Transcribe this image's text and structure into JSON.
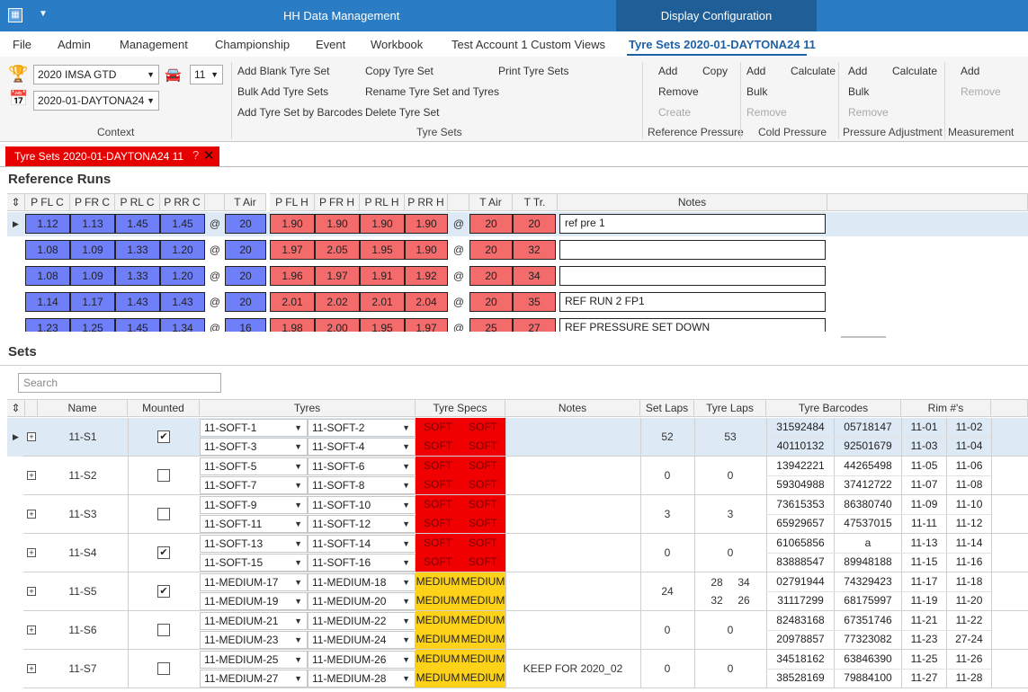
{
  "titlebar": {
    "title": "HH Data Management",
    "context_tab": "Display Configuration",
    "app_icon": "app-logo-icon",
    "menu_icon": "chevron-down-icon"
  },
  "menu": {
    "items": [
      "File",
      "Admin",
      "Management",
      "Championship",
      "Event",
      "Workbook",
      "Test Account 1 Custom Views"
    ],
    "active": "Tyre Sets 2020-01-DAYTONA24 11"
  },
  "ribbon": {
    "context": {
      "championship": "2020 IMSA GTD",
      "car": "11",
      "event": "2020-01-DAYTONA24",
      "label": "Context"
    },
    "tyresets": {
      "add_blank": "Add Blank Tyre Set",
      "bulk_add": "Bulk Add Tyre Sets",
      "add_barcodes": "Add Tyre Set by Barcodes",
      "copy": "Copy Tyre Set",
      "rename": "Rename Tyre Set and Tyres",
      "delete": "Delete Tyre Set",
      "print": "Print Tyre Sets",
      "label": "Tyre Sets"
    },
    "refpressure": {
      "add": "Add",
      "copy": "Copy",
      "remove": "Remove",
      "create": "Create",
      "label": "Reference Pressure"
    },
    "coldpressure": {
      "add": "Add",
      "calculate": "Calculate",
      "bulk": "Bulk",
      "remove": "Remove",
      "label": "Cold Pressure"
    },
    "pressureadj": {
      "add": "Add",
      "calculate": "Calculate",
      "bulk": "Bulk",
      "remove": "Remove",
      "label": "Pressure Adjustment"
    },
    "measurement": {
      "add": "Add",
      "remove": "Remove",
      "label": "Measurement"
    }
  },
  "doctab": {
    "title": "Tyre Sets 2020-01-DAYTONA24 11",
    "help": "?",
    "close": "✕"
  },
  "reference_runs": {
    "title": "Reference Runs",
    "headers": [
      "P FL C",
      "P FR C",
      "P RL C",
      "P RR C",
      "T Air",
      "P FL H",
      "P FR H",
      "P RL H",
      "P RR H",
      "T Air",
      "T Tr.",
      "Notes"
    ],
    "rows": [
      {
        "cold": [
          "1.12",
          "1.13",
          "1.45",
          "1.45"
        ],
        "tair_c": "20",
        "hot": [
          "1.90",
          "1.90",
          "1.90",
          "1.90"
        ],
        "tair_h": "20",
        "ttr": "20",
        "note": "ref pre 1"
      },
      {
        "cold": [
          "1.08",
          "1.09",
          "1.33",
          "1.20"
        ],
        "tair_c": "20",
        "hot": [
          "1.97",
          "2.05",
          "1.95",
          "1.90"
        ],
        "tair_h": "20",
        "ttr": "32",
        "note": ""
      },
      {
        "cold": [
          "1.08",
          "1.09",
          "1.33",
          "1.20"
        ],
        "tair_c": "20",
        "hot": [
          "1.96",
          "1.97",
          "1.91",
          "1.92"
        ],
        "tair_h": "20",
        "ttr": "34",
        "note": ""
      },
      {
        "cold": [
          "1.14",
          "1.17",
          "1.43",
          "1.43"
        ],
        "tair_c": "20",
        "hot": [
          "2.01",
          "2.02",
          "2.01",
          "2.04"
        ],
        "tair_h": "20",
        "ttr": "35",
        "note": "REF RUN 2 FP1"
      },
      {
        "cold": [
          "1.23",
          "1.25",
          "1.45",
          "1.34"
        ],
        "tair_c": "16",
        "hot": [
          "1.98",
          "2.00",
          "1.95",
          "1.97"
        ],
        "tair_h": "25",
        "ttr": "27",
        "note": "REF PRESSURE SET DOWN"
      }
    ]
  },
  "sets": {
    "title": "Sets",
    "search_placeholder": "Search",
    "headers": [
      "Name",
      "Mounted",
      "Tyres",
      "Tyre Specs",
      "Notes",
      "Set Laps",
      "Tyre Laps",
      "Tyre Barcodes",
      "Rim #'s"
    ],
    "rows": [
      {
        "name": "11-S1",
        "mounted": true,
        "tyres": [
          "11-SOFT-1",
          "11-SOFT-2",
          "11-SOFT-3",
          "11-SOFT-4"
        ],
        "spec": "SOFT",
        "note": "",
        "set_laps": "52",
        "tyre_laps": [
          "53"
        ],
        "barcodes": [
          "31592484",
          "05718147",
          "40110132",
          "92501679"
        ],
        "rims": [
          "11-01",
          "11-02",
          "11-03",
          "11-04"
        ]
      },
      {
        "name": "11-S2",
        "mounted": false,
        "tyres": [
          "11-SOFT-5",
          "11-SOFT-6",
          "11-SOFT-7",
          "11-SOFT-8"
        ],
        "spec": "SOFT",
        "note": "",
        "set_laps": "0",
        "tyre_laps": [
          "0"
        ],
        "barcodes": [
          "13942221",
          "44265498",
          "59304988",
          "37412722"
        ],
        "rims": [
          "11-05",
          "11-06",
          "11-07",
          "11-08"
        ]
      },
      {
        "name": "11-S3",
        "mounted": false,
        "tyres": [
          "11-SOFT-9",
          "11-SOFT-10",
          "11-SOFT-11",
          "11-SOFT-12"
        ],
        "spec": "SOFT",
        "note": "",
        "set_laps": "3",
        "tyre_laps": [
          "3"
        ],
        "barcodes": [
          "73615353",
          "86380740",
          "65929657",
          "47537015"
        ],
        "rims": [
          "11-09",
          "11-10",
          "11-11",
          "11-12"
        ]
      },
      {
        "name": "11-S4",
        "mounted": true,
        "tyres": [
          "11-SOFT-13",
          "11-SOFT-14",
          "11-SOFT-15",
          "11-SOFT-16"
        ],
        "spec": "SOFT",
        "note": "",
        "set_laps": "0",
        "tyre_laps": [
          "0"
        ],
        "barcodes": [
          "61065856",
          "a",
          "83888547",
          "89948188"
        ],
        "rims": [
          "11-13",
          "11-14",
          "11-15",
          "11-16"
        ]
      },
      {
        "name": "11-S5",
        "mounted": true,
        "tyres": [
          "11-MEDIUM-17",
          "11-MEDIUM-18",
          "11-MEDIUM-19",
          "11-MEDIUM-20"
        ],
        "spec": "MEDIUM",
        "note": "",
        "set_laps": "24",
        "tyre_laps": [
          "28",
          "34",
          "32",
          "26"
        ],
        "barcodes": [
          "02791944",
          "74329423",
          "31117299",
          "68175997"
        ],
        "rims": [
          "11-17",
          "11-18",
          "11-19",
          "11-20"
        ]
      },
      {
        "name": "11-S6",
        "mounted": false,
        "tyres": [
          "11-MEDIUM-21",
          "11-MEDIUM-22",
          "11-MEDIUM-23",
          "11-MEDIUM-24"
        ],
        "spec": "MEDIUM",
        "note": "",
        "set_laps": "0",
        "tyre_laps": [
          "0"
        ],
        "barcodes": [
          "82483168",
          "67351746",
          "20978857",
          "77323082"
        ],
        "rims": [
          "11-21",
          "11-22",
          "11-23",
          "27-24"
        ]
      },
      {
        "name": "11-S7",
        "mounted": false,
        "tyres": [
          "11-MEDIUM-25",
          "11-MEDIUM-26",
          "11-MEDIUM-27",
          "11-MEDIUM-28"
        ],
        "spec": "MEDIUM",
        "note": "KEEP FOR 2020_02",
        "set_laps": "0",
        "tyre_laps": [
          "0"
        ],
        "barcodes": [
          "34518162",
          "63846390",
          "38528169",
          "79884100"
        ],
        "rims": [
          "11-25",
          "11-26",
          "11-27",
          "11-28"
        ]
      }
    ]
  },
  "colors": {
    "title_bar": "#2a7cc4",
    "context_tab": "#1f5e97",
    "cold_pressure": "#6f7ff7",
    "hot_pressure": "#f36b6b",
    "soft": "#f00000",
    "medium": "#ffd21a",
    "doc_tab": "#e60000"
  }
}
